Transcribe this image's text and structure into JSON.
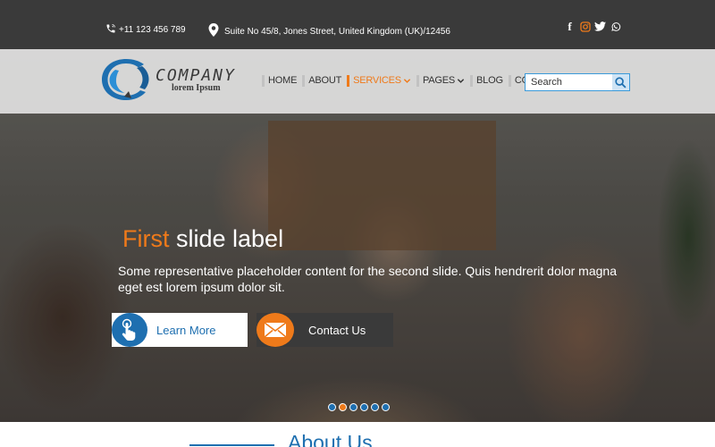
{
  "topbar": {
    "phone": "+11 123 456 789",
    "address": "Suite No 45/8, Jones Street, United Kingdom  (UK)/12456",
    "social_icons": [
      "facebook-icon",
      "instagram-icon",
      "twitter-icon",
      "whatsapp-icon"
    ]
  },
  "brand": {
    "name": "COMPANY",
    "tagline": "lorem Ipsum"
  },
  "nav": {
    "items": [
      {
        "label": "HOME"
      },
      {
        "label": "ABOUT"
      },
      {
        "label": "SERVICES",
        "active": true,
        "dropdown": true
      },
      {
        "label": "PAGES",
        "dropdown": true
      },
      {
        "label": "BLOG"
      },
      {
        "label": "CONTACT"
      }
    ]
  },
  "search": {
    "placeholder": "Search"
  },
  "hero": {
    "title_accent": "First",
    "title_rest": " slide label",
    "text": "Some representative placeholder content for the second slide. Quis hendrerit dolor magna eget est lorem ipsum dolor sit.",
    "learn_more": "Learn More",
    "contact_us": "Contact Us",
    "slide_count": 6,
    "active_slide": 2
  },
  "about": {
    "title": "About Us"
  },
  "colors": {
    "accent_orange": "#ef7a1a",
    "brand_blue": "#1e6fb0",
    "dark_bar": "#3a3a3a"
  }
}
